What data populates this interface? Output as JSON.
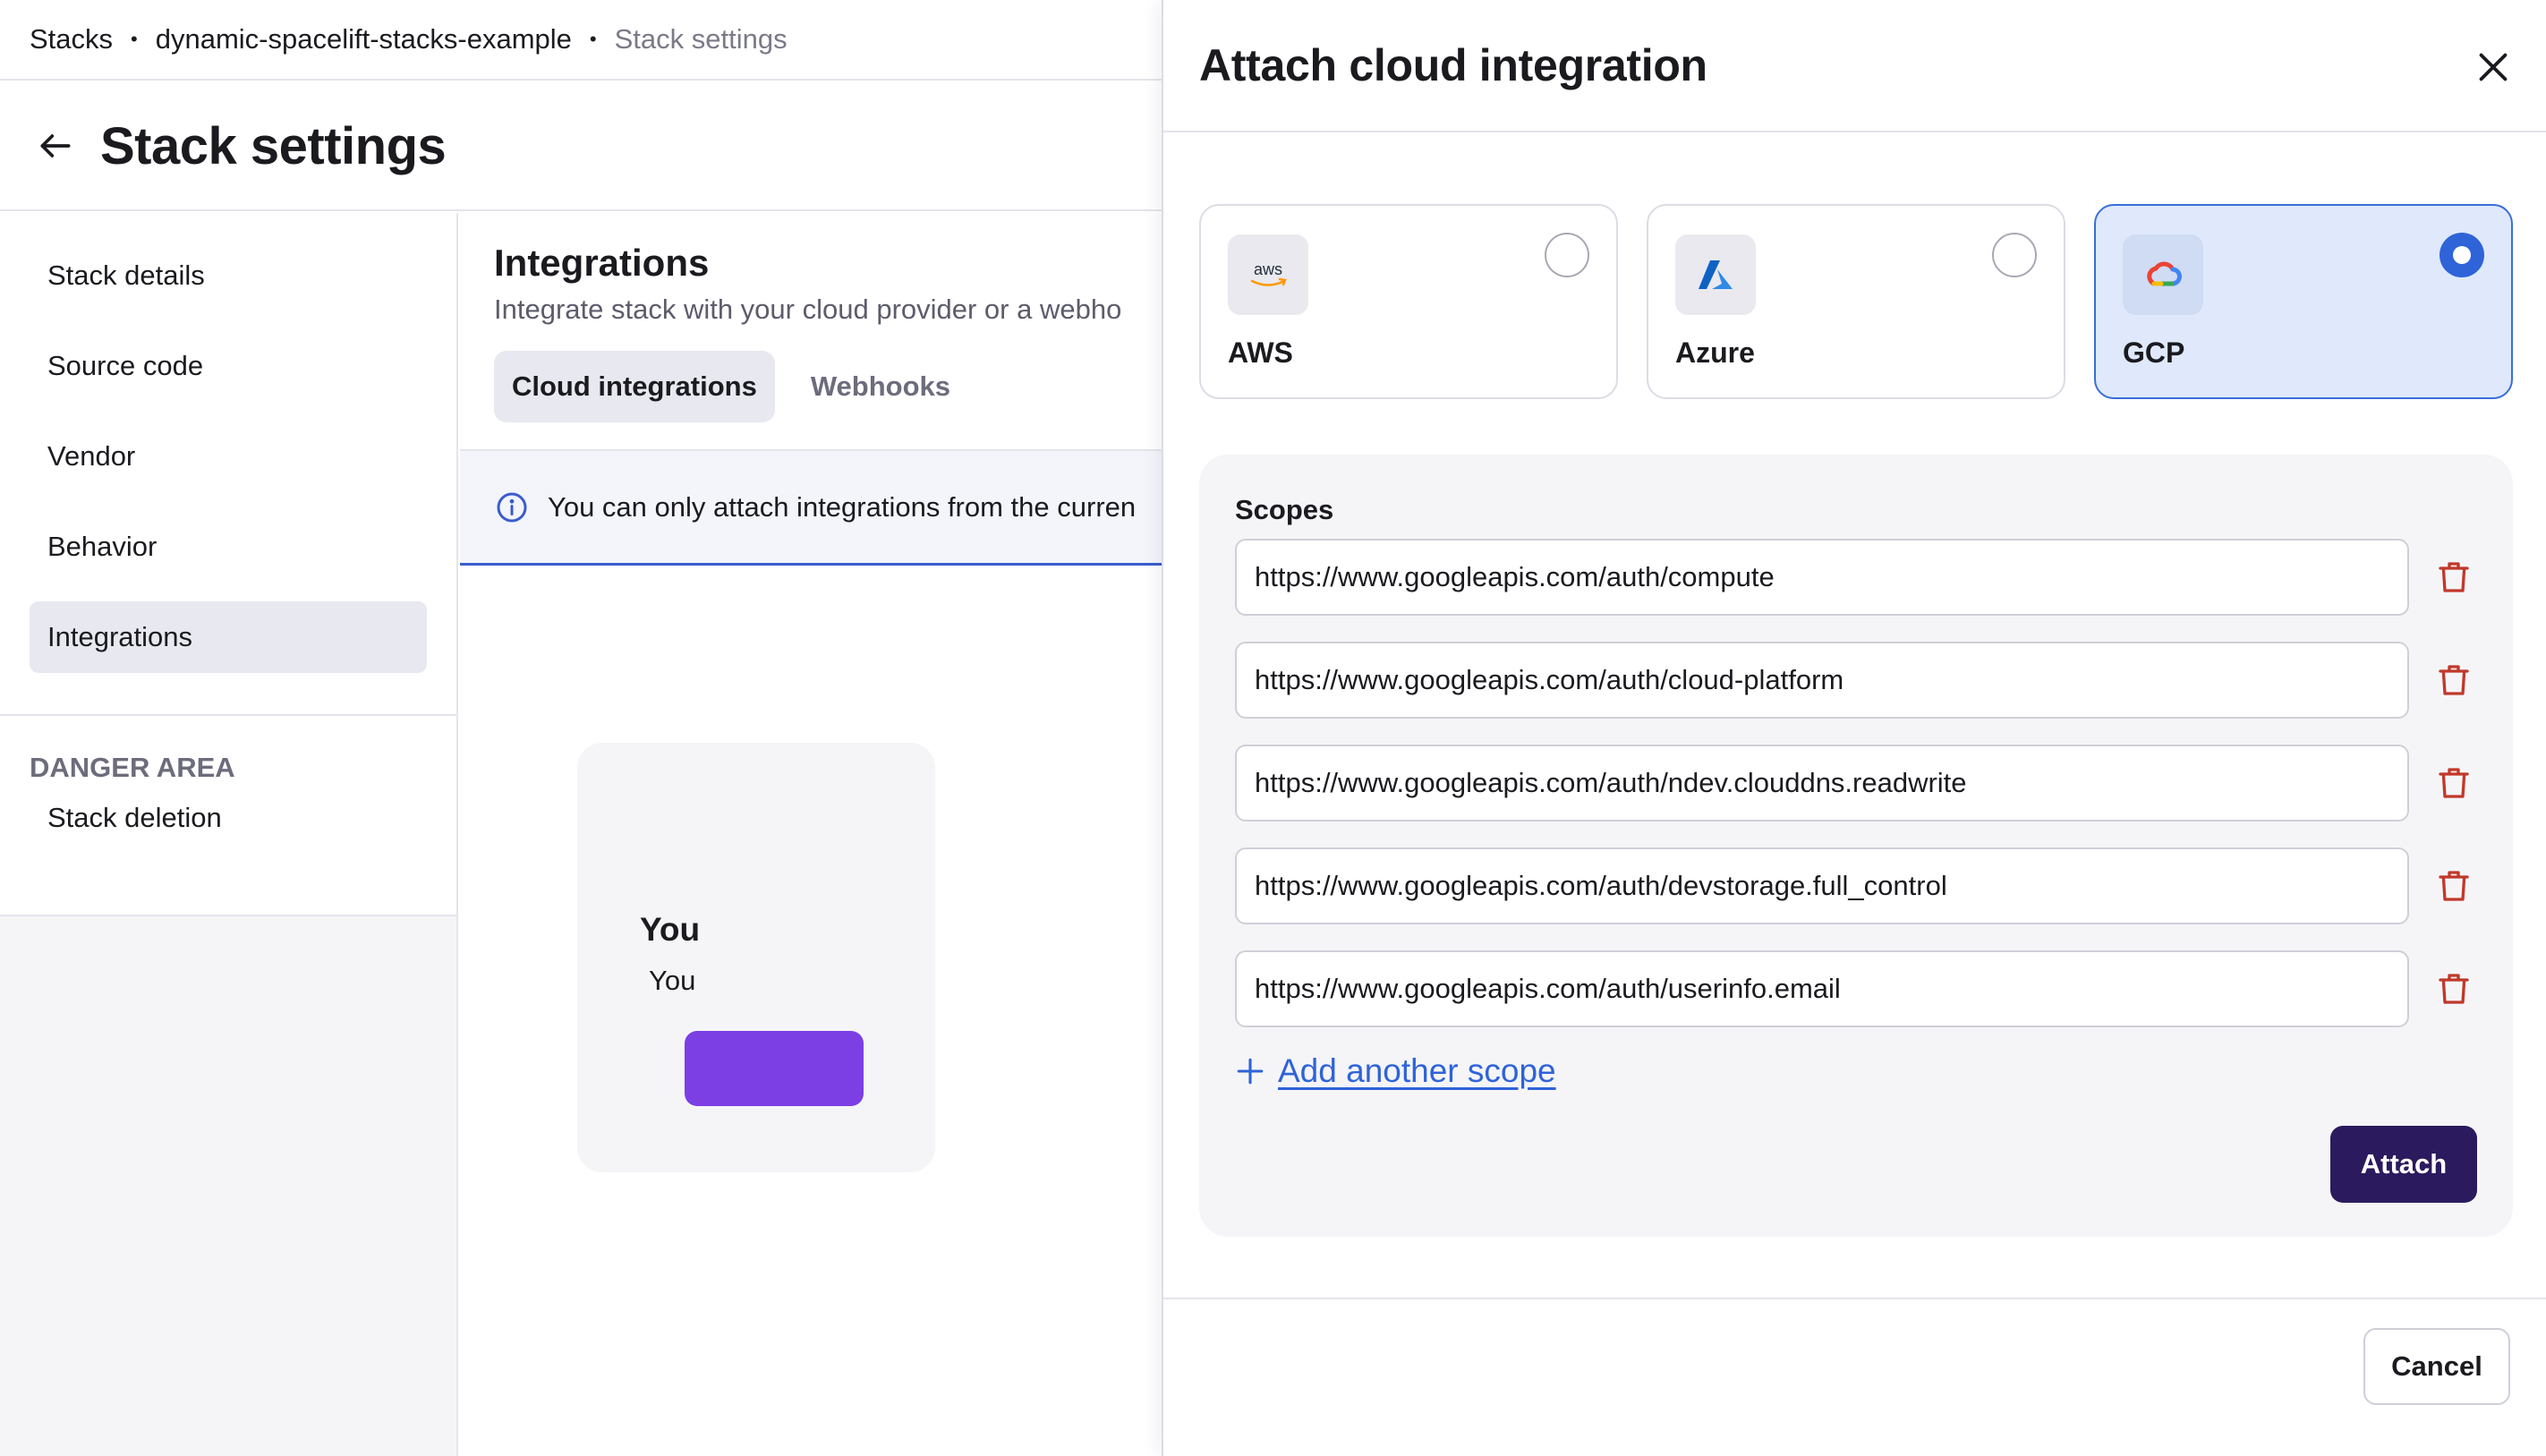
{
  "breadcrumb": {
    "items": [
      "Stacks",
      "dynamic-spacelift-stacks-example",
      "Stack settings"
    ],
    "separator": "•"
  },
  "page": {
    "title": "Stack settings",
    "back_icon": "arrow-left-icon"
  },
  "sidebar": {
    "items": [
      "Stack details",
      "Source code",
      "Vendor",
      "Behavior",
      "Integrations"
    ],
    "active": "Integrations",
    "danger_label": "DANGER AREA",
    "danger_items": [
      "Stack deletion"
    ]
  },
  "main": {
    "title": "Integrations",
    "subtitle": "Integrate stack with your cloud provider or a webho",
    "tabs": [
      "Cloud integrations",
      "Webhooks"
    ],
    "active_tab": "Cloud integrations",
    "info": "You can only attach integrations from the curren",
    "empty_title": "You",
    "empty_subtitle": "You"
  },
  "drawer": {
    "title": "Attach cloud integration",
    "providers": [
      {
        "name": "AWS",
        "logo": "aws-logo-icon",
        "selected": false
      },
      {
        "name": "Azure",
        "logo": "azure-logo-icon",
        "selected": false
      },
      {
        "name": "GCP",
        "logo": "gcp-logo-icon",
        "selected": true
      }
    ],
    "scopes_label": "Scopes",
    "scopes": [
      "https://www.googleapis.com/auth/compute",
      "https://www.googleapis.com/auth/cloud-platform",
      "https://www.googleapis.com/auth/ndev.clouddns.readwrite",
      "https://www.googleapis.com/auth/devstorage.full_control",
      "https://www.googleapis.com/auth/userinfo.email"
    ],
    "add_scope_label": "Add another scope",
    "attach_label": "Attach",
    "cancel_label": "Cancel",
    "logo_text_aws": "aws"
  },
  "colors": {
    "accent": "#2f63d8",
    "primary_button": "#2b1a5e",
    "danger": "#c0392b",
    "selected_card": "#dfe9fb"
  }
}
